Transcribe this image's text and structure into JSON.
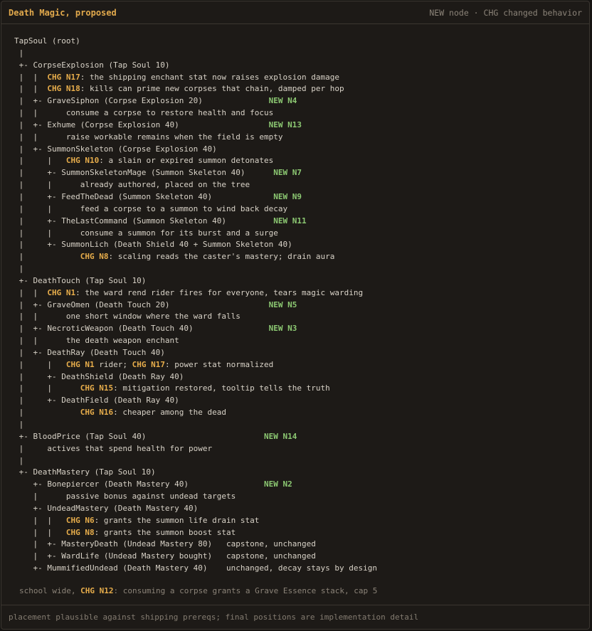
{
  "header": {
    "title": "Death Magic, proposed",
    "legend": "NEW node · CHG changed behavior"
  },
  "tree": [
    [
      {
        "t": "TapSoul (root)"
      }
    ],
    [
      {
        "t": " |"
      }
    ],
    [
      {
        "t": " +- CorpseExplosion (Tap Soul 10)"
      }
    ],
    [
      {
        "t": " |  |  "
      },
      {
        "c": "CHG N17"
      },
      {
        "t": ": the shipping enchant stat now raises explosion damage"
      }
    ],
    [
      {
        "t": " |  |  "
      },
      {
        "c": "CHG N18"
      },
      {
        "t": ": kills can prime new corpses that chain, damped per hop"
      }
    ],
    [
      {
        "t": " |  +- GraveSiphon (Corpse Explosion 20)              "
      },
      {
        "n": "NEW N4"
      }
    ],
    [
      {
        "t": " |  |      consume a corpse to restore health and focus"
      }
    ],
    [
      {
        "t": " |  +- Exhume (Corpse Explosion 40)                   "
      },
      {
        "n": "NEW N13"
      }
    ],
    [
      {
        "t": " |  |      raise workable remains when the field is empty"
      }
    ],
    [
      {
        "t": " |  +- SummonSkeleton (Corpse Explosion 40)"
      }
    ],
    [
      {
        "t": " |     |   "
      },
      {
        "c": "CHG N10"
      },
      {
        "t": ": a slain or expired summon detonates"
      }
    ],
    [
      {
        "t": " |     +- SummonSkeletonMage (Summon Skeleton 40)      "
      },
      {
        "n": "NEW N7"
      }
    ],
    [
      {
        "t": " |     |      already authored, placed on the tree"
      }
    ],
    [
      {
        "t": " |     +- FeedTheDead (Summon Skeleton 40)             "
      },
      {
        "n": "NEW N9"
      }
    ],
    [
      {
        "t": " |     |      feed a corpse to a summon to wind back decay"
      }
    ],
    [
      {
        "t": " |     +- TheLastCommand (Summon Skeleton 40)          "
      },
      {
        "n": "NEW N11"
      }
    ],
    [
      {
        "t": " |     |      consume a summon for its burst and a surge"
      }
    ],
    [
      {
        "t": " |     +- SummonLich (Death Shield 40 + Summon Skeleton 40)"
      }
    ],
    [
      {
        "t": " |            "
      },
      {
        "c": "CHG N8"
      },
      {
        "t": ": scaling reads the caster's mastery; drain aura"
      }
    ],
    [
      {
        "t": " |"
      }
    ],
    [
      {
        "t": " +- DeathTouch (Tap Soul 10)"
      }
    ],
    [
      {
        "t": " |  |  "
      },
      {
        "c": "CHG N1"
      },
      {
        "t": ": the ward rend rider fires for everyone, tears magic warding"
      }
    ],
    [
      {
        "t": " |  +- GraveOmen (Death Touch 20)                     "
      },
      {
        "n": "NEW N5"
      }
    ],
    [
      {
        "t": " |  |      one short window where the ward falls"
      }
    ],
    [
      {
        "t": " |  +- NecroticWeapon (Death Touch 40)                "
      },
      {
        "n": "NEW N3"
      }
    ],
    [
      {
        "t": " |  |      the death weapon enchant"
      }
    ],
    [
      {
        "t": " |  +- DeathRay (Death Touch 40)"
      }
    ],
    [
      {
        "t": " |     |   "
      },
      {
        "c": "CHG N1"
      },
      {
        "t": " rider; "
      },
      {
        "c": "CHG N17"
      },
      {
        "t": ": power stat normalized"
      }
    ],
    [
      {
        "t": " |     +- DeathShield (Death Ray 40)"
      }
    ],
    [
      {
        "t": " |     |      "
      },
      {
        "c": "CHG N15"
      },
      {
        "t": ": mitigation restored, tooltip tells the truth"
      }
    ],
    [
      {
        "t": " |     +- DeathField (Death Ray 40)"
      }
    ],
    [
      {
        "t": " |            "
      },
      {
        "c": "CHG N16"
      },
      {
        "t": ": cheaper among the dead"
      }
    ],
    [
      {
        "t": " |"
      }
    ],
    [
      {
        "t": " +- BloodPrice (Tap Soul 40)                         "
      },
      {
        "n": "NEW N14"
      }
    ],
    [
      {
        "t": " |     actives that spend health for power"
      }
    ],
    [
      {
        "t": " |"
      }
    ],
    [
      {
        "t": " +- DeathMastery (Tap Soul 10)"
      }
    ],
    [
      {
        "t": "    +- Bonepiercer (Death Mastery 40)                "
      },
      {
        "n": "NEW N2"
      }
    ],
    [
      {
        "t": "    |      passive bonus against undead targets"
      }
    ],
    [
      {
        "t": "    +- UndeadMastery (Death Mastery 40)"
      }
    ],
    [
      {
        "t": "    |  |   "
      },
      {
        "c": "CHG N6"
      },
      {
        "t": ": grants the summon life drain stat"
      }
    ],
    [
      {
        "t": "    |  |   "
      },
      {
        "c": "CHG N8"
      },
      {
        "t": ": grants the summon boost stat"
      }
    ],
    [
      {
        "t": "    |  +- MasteryDeath (Undead Mastery 80)   capstone, unchanged"
      }
    ],
    [
      {
        "t": "    |  +- WardLife (Undead Mastery bought)   capstone, unchanged"
      }
    ],
    [
      {
        "t": "    +- MummifiedUndead (Death Mastery 40)    unchanged, decay stays by design"
      }
    ]
  ],
  "school_note": {
    "prefix": "school wide, ",
    "chg": "CHG N12",
    "text": ": consuming a corpse grants a Grave Essence stack, cap 5"
  },
  "footer": {
    "text": "placement plausible against shipping prereqs; final positions are implementation detail"
  }
}
